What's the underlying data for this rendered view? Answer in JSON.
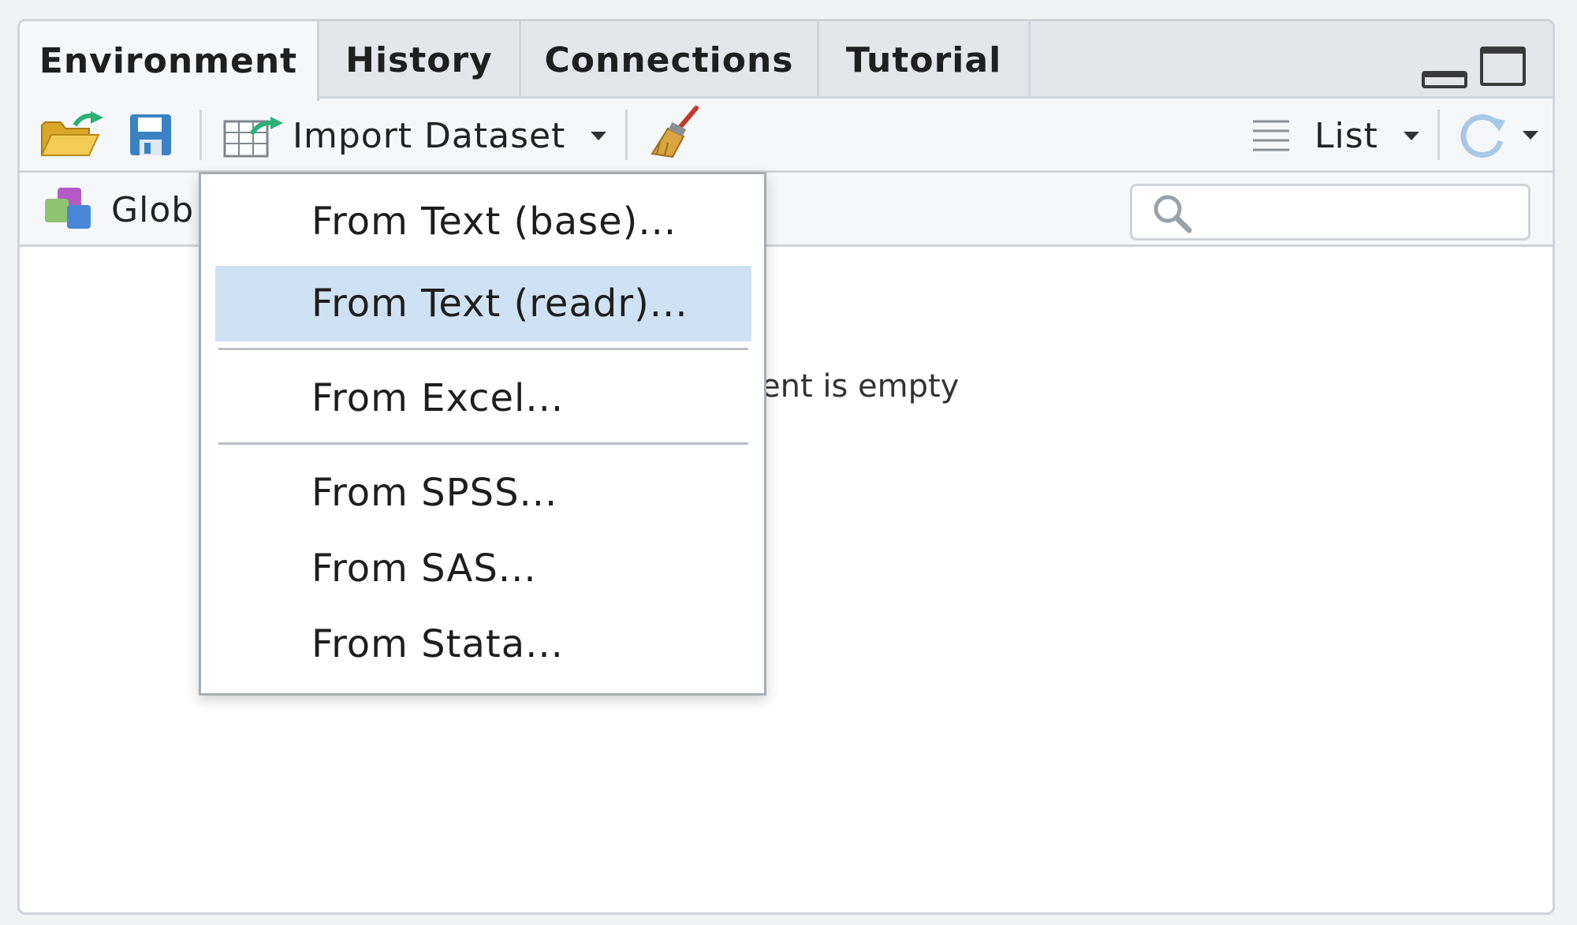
{
  "tabs": [
    {
      "label": "Environment",
      "active": true
    },
    {
      "label": "History",
      "active": false
    },
    {
      "label": "Connections",
      "active": false
    },
    {
      "label": "Tutorial",
      "active": false
    }
  ],
  "toolbar": {
    "import_label": "Import Dataset",
    "view_label": "List"
  },
  "env": {
    "scope_label": "Glob",
    "search_placeholder": "",
    "empty_message": "ent is empty"
  },
  "menu": {
    "items": [
      {
        "label": "From Text (base)...",
        "highlighted": false
      },
      {
        "label": "From Text (readr)...",
        "highlighted": true
      },
      {
        "label": "From Excel...",
        "highlighted": false
      },
      {
        "label": "From SPSS...",
        "highlighted": false
      },
      {
        "label": "From SAS...",
        "highlighted": false
      },
      {
        "label": "From Stata...",
        "highlighted": false
      }
    ]
  },
  "colors": {
    "highlight": "#cfe2f4",
    "save_blue": "#3b82c4",
    "arrow_green": "#2bb07a",
    "folder_yellow": "#e8b93a"
  },
  "icons": [
    "open-folder-icon",
    "save-icon",
    "import-table-icon",
    "broom-icon",
    "list-lines-icon",
    "refresh-icon",
    "environment-cubes-icon",
    "search-icon",
    "minimize-icon",
    "maximize-icon",
    "chevron-down-icon"
  ]
}
